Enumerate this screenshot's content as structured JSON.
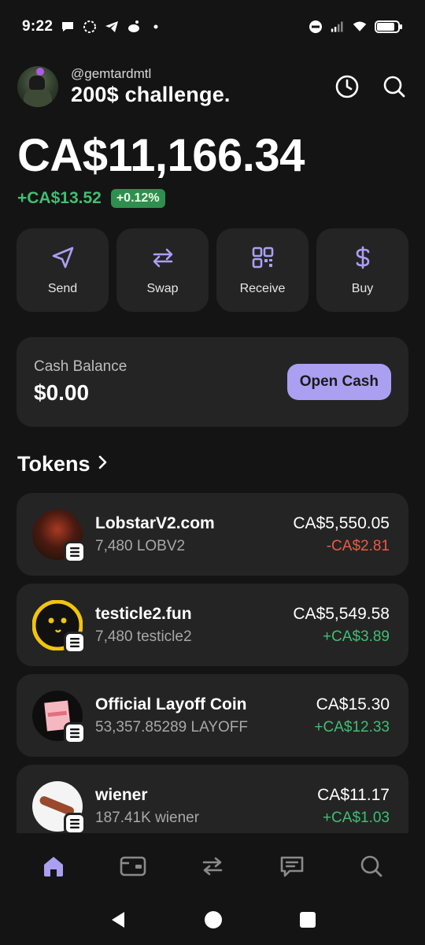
{
  "status": {
    "time": "9:22",
    "left_icons": [
      "chat-bubble-icon",
      "signal-app-icon",
      "telegram-icon",
      "reddit-icon",
      "dot-icon"
    ],
    "right_icons": [
      "do-not-disturb-icon",
      "cell-signal-icon",
      "wifi-icon",
      "battery-icon"
    ]
  },
  "profile": {
    "handle": "@gemtardmtl",
    "name": "200$ challenge."
  },
  "header": {
    "actions": [
      "history-icon",
      "search-icon"
    ]
  },
  "portfolio": {
    "balance": "CA$11,166.34",
    "change_amount": "+CA$13.52",
    "change_percent": "+0.12%"
  },
  "actions": [
    {
      "label": "Send",
      "icon": "send-icon"
    },
    {
      "label": "Swap",
      "icon": "swap-icon"
    },
    {
      "label": "Receive",
      "icon": "qr-code-icon"
    },
    {
      "label": "Buy",
      "icon": "dollar-icon"
    }
  ],
  "cash": {
    "label": "Cash Balance",
    "value": "$0.00",
    "button": "Open Cash"
  },
  "tokens": {
    "title": "Tokens",
    "items": [
      {
        "name": "LobstarV2.com",
        "amount": "7,480 LOBV2",
        "value": "CA$5,550.05",
        "change": "-CA$2.81",
        "direction": "down"
      },
      {
        "name": "testicle2.fun",
        "amount": "7,480 testicle2",
        "value": "CA$5,549.58",
        "change": "+CA$3.89",
        "direction": "up"
      },
      {
        "name": "Official Layoff Coin",
        "amount": "53,357.85289 LAYOFF",
        "value": "CA$15.30",
        "change": "+CA$12.33",
        "direction": "up"
      },
      {
        "name": "wiener",
        "amount": "187.41K wiener",
        "value": "CA$11.17",
        "change": "+CA$1.03",
        "direction": "up"
      }
    ]
  },
  "colors": {
    "background": "#141414",
    "card": "#242424",
    "accent": "#ab9ff2",
    "positive": "#3fbf73",
    "negative": "#eb5a44"
  },
  "bottom_nav": [
    "home-icon",
    "wallet-icon",
    "swap-nav-icon",
    "messages-icon",
    "explore-search-icon"
  ],
  "system_nav": [
    "back-icon",
    "home-circle-icon",
    "recents-icon"
  ]
}
